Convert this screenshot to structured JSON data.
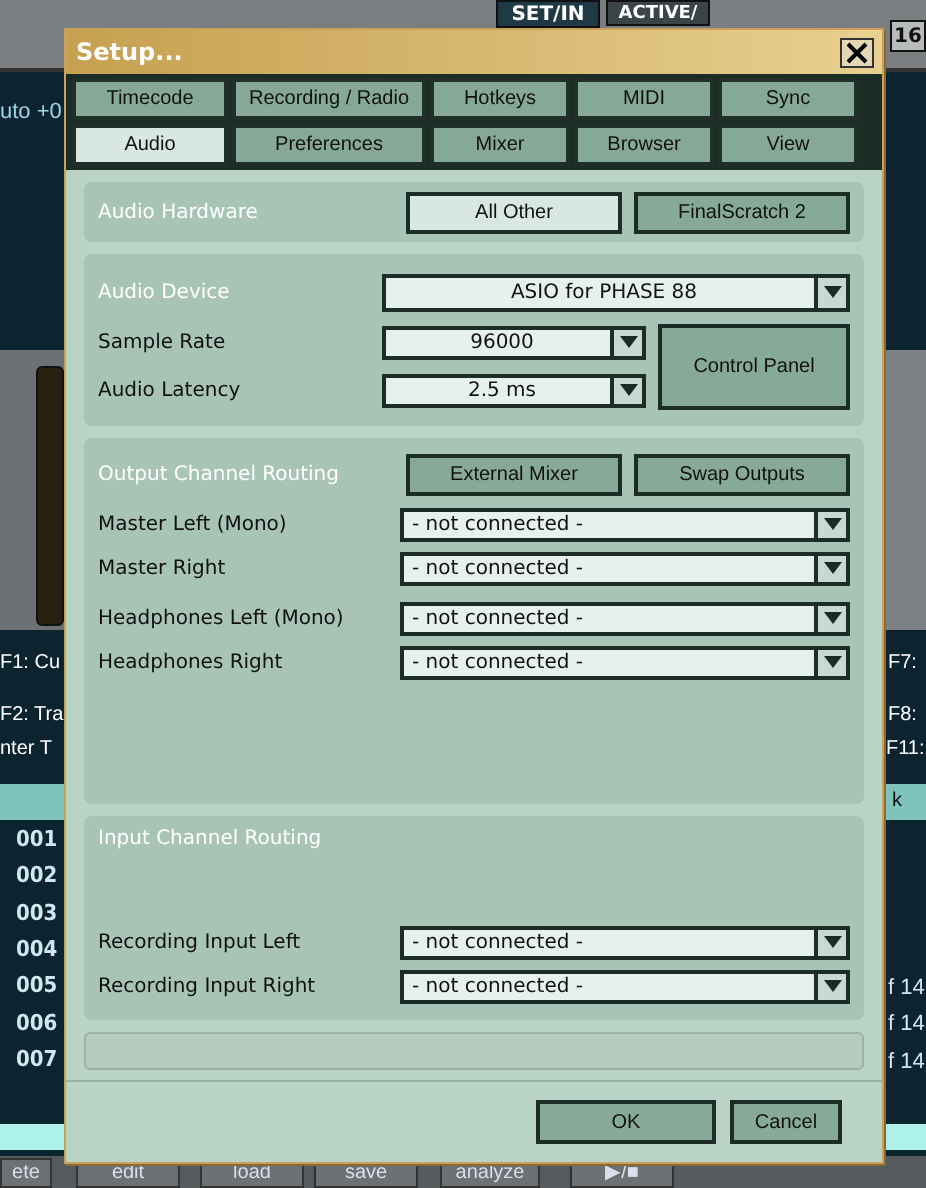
{
  "background_app": {
    "top_buttons": [
      "SET/IN",
      "ACTIVE/",
      "16"
    ],
    "left_readout": "uto +0",
    "left_hotkeys": [
      "F1: Cu",
      "F2: Tra",
      "nter T"
    ],
    "right_hotkeys": [
      "F7:",
      "F8:",
      "F11:"
    ],
    "column_header": "k",
    "track_numbers": [
      "001",
      "002",
      "003",
      "004",
      "005",
      "006",
      "007"
    ],
    "right_cells": [
      "f 14",
      "f 14",
      "f 14"
    ],
    "bottom_buttons": [
      "ete",
      "edit",
      "load",
      "save",
      "analyze",
      "▶/■"
    ]
  },
  "dialog": {
    "title": "Setup...",
    "tabs": [
      {
        "label": "Timecode",
        "selected": false
      },
      {
        "label": "Recording / Radio",
        "selected": false
      },
      {
        "label": "Hotkeys",
        "selected": false
      },
      {
        "label": "MIDI",
        "selected": false
      },
      {
        "label": "Sync",
        "selected": false
      },
      {
        "label": "Audio",
        "selected": true
      },
      {
        "label": "Preferences",
        "selected": false
      },
      {
        "label": "Mixer",
        "selected": false
      },
      {
        "label": "Browser",
        "selected": false
      },
      {
        "label": "View",
        "selected": false
      }
    ],
    "audio_hardware": {
      "label": "Audio Hardware",
      "options": [
        {
          "label": "All Other",
          "selected": true
        },
        {
          "label": "FinalScratch 2",
          "selected": false
        }
      ]
    },
    "audio_device": {
      "label": "Audio Device",
      "value": "ASIO for PHASE 88"
    },
    "sample_rate": {
      "label": "Sample Rate",
      "value": "96000"
    },
    "audio_latency": {
      "label": "Audio Latency",
      "value": "2.5 ms"
    },
    "control_panel": "Control Panel",
    "output_routing": {
      "label": "Output Channel Routing",
      "buttons": [
        "External Mixer",
        "Swap Outputs"
      ],
      "channels": [
        {
          "label": "Master Left (Mono)",
          "value": "- not connected -"
        },
        {
          "label": "Master Right",
          "value": "- not connected -"
        },
        {
          "label": "Headphones Left (Mono)",
          "value": "- not connected -"
        },
        {
          "label": "Headphones Right",
          "value": "- not connected -"
        }
      ]
    },
    "input_routing": {
      "label": "Input Channel Routing",
      "channels": [
        {
          "label": "Recording Input Left",
          "value": "- not connected -"
        },
        {
          "label": "Recording Input Right",
          "value": "- not connected -"
        }
      ]
    },
    "buttons": [
      "OK",
      "Cancel"
    ]
  }
}
